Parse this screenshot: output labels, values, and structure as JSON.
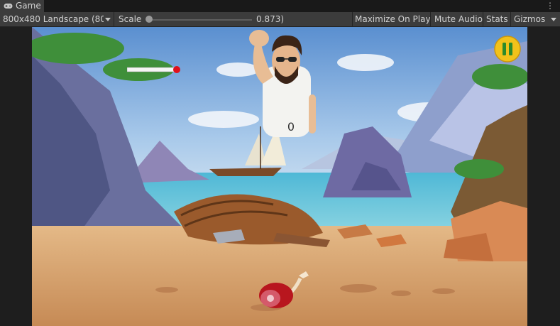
{
  "window": {
    "tab_label": "Game",
    "tab_icon": "gamepad-icon",
    "menu_icon": "kebab-menu-icon"
  },
  "toolbar": {
    "resolution_label": "800x480 Landscape (80(",
    "scale_label": "Scale",
    "scale_value": "0.873)",
    "maximize_label": "Maximize On Play",
    "mute_label": "Mute Audio",
    "stats_label": "Stats",
    "gizmos_label": "Gizmos"
  },
  "game": {
    "score": "0",
    "pause_icon": "pause-icon",
    "health_level": 0.9,
    "colors": {
      "pause_bg": "#f2c21a",
      "pause_fg": "#2d8a2a",
      "health_marker": "#e0101a"
    }
  }
}
